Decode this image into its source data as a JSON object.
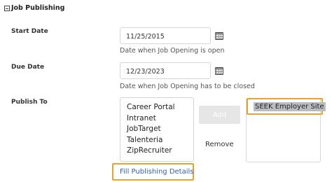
{
  "section": {
    "title": "Job Publishing"
  },
  "start_date": {
    "label": "Start Date",
    "value": "11/25/2015",
    "hint": "Date when Job Opening is open"
  },
  "due_date": {
    "label": "Due Date",
    "value": "12/23/2023",
    "hint": "Date when Job Opening has to be closed"
  },
  "publish_to": {
    "label": "Publish To",
    "available": [
      "Career Portal",
      "Intranet",
      "JobTarget",
      "Talenteria",
      "ZipRecruiter"
    ],
    "add_label": "Add",
    "remove_label": "Remove",
    "selected": [
      "SEEK Employer Site"
    ]
  },
  "fill_details_label": "Fill Publishing Details",
  "colors": {
    "highlight": "#e8a32d",
    "link": "#2f5fb8",
    "selected_bg": "#b9bcc0"
  }
}
